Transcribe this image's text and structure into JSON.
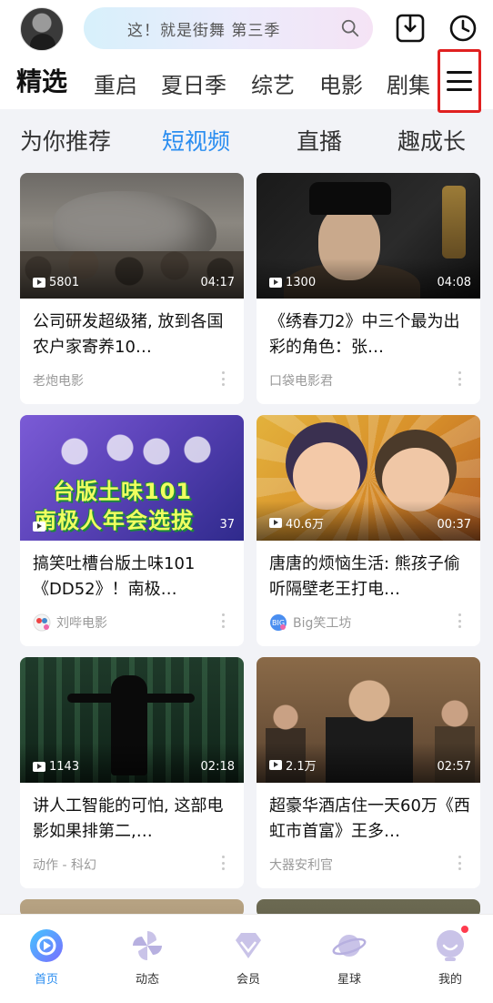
{
  "header": {
    "search_placeholder": "这！就是街舞 第三季",
    "top_tabs": [
      "精选",
      "重启",
      "夏日季",
      "综艺",
      "电影",
      "剧集"
    ],
    "active_top_tab": "精选"
  },
  "sub_tabs": {
    "items": [
      "为你推荐",
      "短视频",
      "直播",
      "趣成长"
    ],
    "active": "短视频"
  },
  "feed": [
    {
      "title": "公司研发超级猪, 放到各国农户家寄养10…",
      "plays": "5801",
      "duration": "04:17",
      "author": "老炮电影"
    },
    {
      "title": "《绣春刀2》中三个最为出彩的角色：张…",
      "plays": "1300",
      "duration": "04:08",
      "author": "口袋电影君"
    },
    {
      "title": "搞笑吐槽台版土味101《DD52》！南极…",
      "plays": "",
      "duration": "37",
      "author": "刘哔电影",
      "thumb_caption_1": "台版土味101",
      "thumb_caption_2": "南极人年会选拔"
    },
    {
      "title": "唐唐的烦恼生活: 熊孩子偷听隔壁老王打电…",
      "plays": "40.6万",
      "duration": "00:37",
      "author": "Big笑工坊"
    },
    {
      "title": "讲人工智能的可怕, 这部电影如果排第二,…",
      "plays": "1143",
      "duration": "02:18",
      "author": "动作 - 科幻"
    },
    {
      "title": "超豪华酒店住一天60万《西虹市首富》王多…",
      "plays": "2.1万",
      "duration": "02:57",
      "author": "大器安利官"
    }
  ],
  "bottom_nav": {
    "items": [
      "首页",
      "动态",
      "会员",
      "星球",
      "我的"
    ],
    "active": "首页"
  },
  "colors": {
    "accent": "#2a8df0",
    "highlight_border": "#e02020",
    "notification_dot": "#ff3b4e"
  }
}
